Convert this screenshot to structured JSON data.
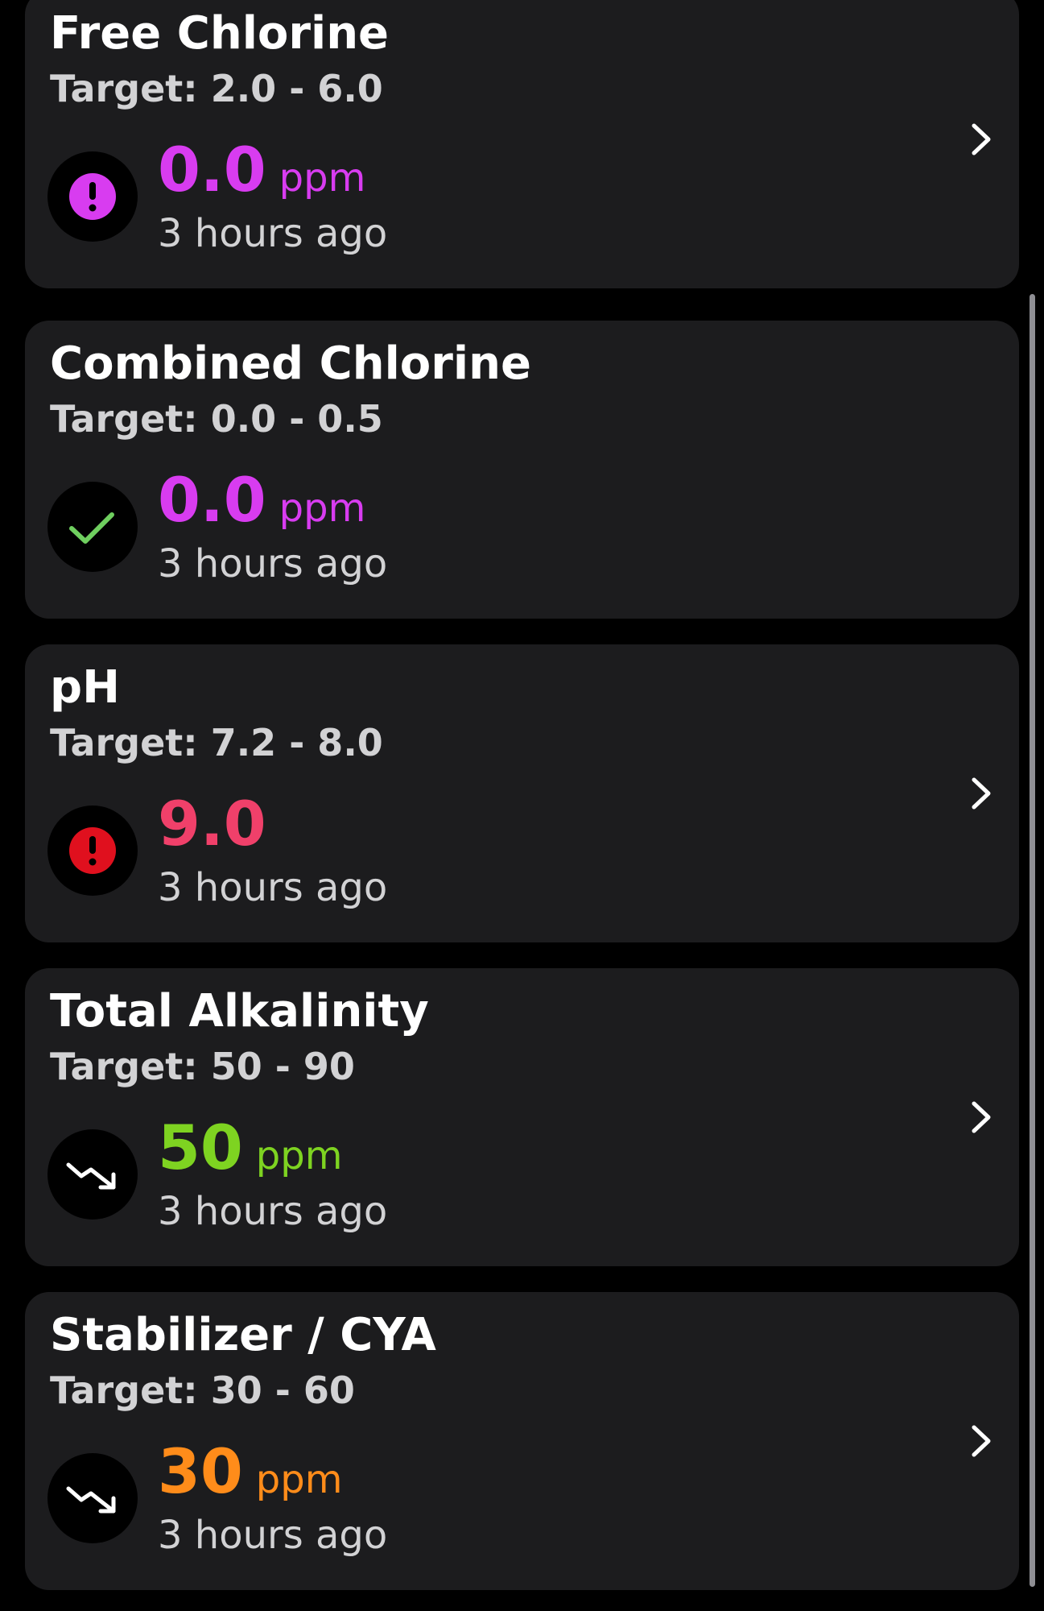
{
  "colors": {
    "background": "#000000",
    "card": "#1c1c1e",
    "title": "#ffffff",
    "secondary": "#d2d2d4",
    "magenta": "#d83cf0",
    "red": "#f0406a",
    "green": "#7ed321",
    "orange": "#ff8c1a",
    "check_green": "#6fcf5f",
    "alert_red": "#e0101e"
  },
  "cards": [
    {
      "title": "Free Chlorine",
      "target": "Target: 2.0 - 6.0",
      "value": "0.0",
      "unit": "ppm",
      "time": "3 hours ago",
      "status_icon": "exclamation-icon",
      "value_color": "#d83cf0",
      "has_chevron": true
    },
    {
      "title": "Combined Chlorine",
      "target": "Target: 0.0 - 0.5",
      "value": "0.0",
      "unit": "ppm",
      "time": "3 hours ago",
      "status_icon": "checkmark-icon",
      "value_color": "#d83cf0",
      "has_chevron": false
    },
    {
      "title": "pH",
      "target": "Target: 7.2 - 8.0",
      "value": "9.0",
      "unit": "",
      "time": "3 hours ago",
      "status_icon": "exclamation-icon",
      "value_color": "#f0406a",
      "has_chevron": true
    },
    {
      "title": "Total Alkalinity",
      "target": "Target: 50 - 90",
      "value": "50",
      "unit": "ppm",
      "time": "3 hours ago",
      "status_icon": "trend-down-icon",
      "value_color": "#7ed321",
      "has_chevron": true
    },
    {
      "title": "Stabilizer / CYA",
      "target": "Target: 30 - 60",
      "value": "30",
      "unit": "ppm",
      "time": "3 hours ago",
      "status_icon": "trend-down-icon",
      "value_color": "#ff8c1a",
      "has_chevron": true
    }
  ]
}
